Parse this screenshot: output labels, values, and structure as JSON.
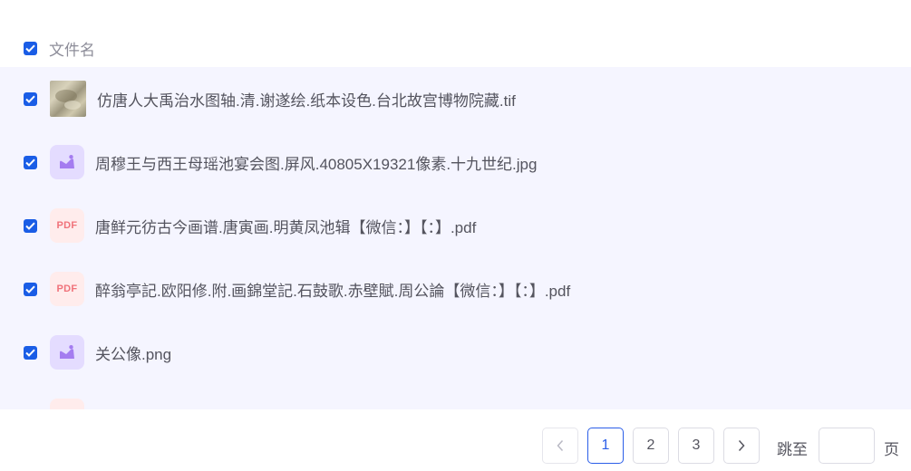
{
  "header": {
    "select_all_checked": true,
    "column_label": "文件名"
  },
  "files": [
    {
      "name": "仿唐人大禹治水图轴.清.谢遂绘.纸本设色.台北故宫博物院藏.tif",
      "type": "tif",
      "checked": true
    },
    {
      "name": "周穆王与西王母瑶池宴会图.屏风.40805X19321像素.十九世纪.jpg",
      "type": "image",
      "checked": true
    },
    {
      "name": "唐鲜元彷古今画谱.唐寅画.明黄凤池辑【微信：】【：】.pdf",
      "type": "pdf",
      "icon_text": "PDF",
      "checked": true
    },
    {
      "name": "醉翁亭記.欧阳修.附.画錦堂記.石鼓歌.赤壁賦.周公論【微信：】【：】.pdf",
      "type": "pdf",
      "icon_text": "PDF",
      "checked": true
    },
    {
      "name": "关公像.png",
      "type": "image",
      "checked": true
    }
  ],
  "pagination": {
    "prev_icon": "chevron-left-icon",
    "next_icon": "chevron-right-icon",
    "pages": [
      "1",
      "2",
      "3"
    ],
    "current_page": "1",
    "jump_label": "跳至",
    "jump_value": "",
    "page_suffix": "页"
  },
  "colors": {
    "accent": "#1a5de6",
    "list_bg": "#f5f5ff",
    "pdf_icon": "#f0727a",
    "image_icon": "#a47cf0"
  }
}
